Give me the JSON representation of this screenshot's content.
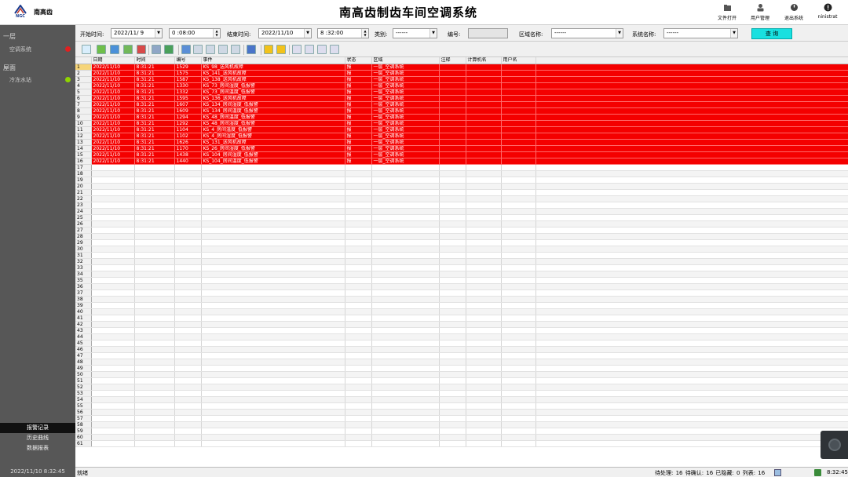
{
  "header": {
    "logo_text": "NGC",
    "company": "南高齿",
    "title": "南高齿制齿车间空调系统",
    "buttons": [
      {
        "label": "文件打开",
        "icon": "folder-icon"
      },
      {
        "label": "用户管理",
        "icon": "user-admin-icon"
      },
      {
        "label": "退出系统",
        "icon": "power-icon"
      },
      {
        "label": "ninistrat",
        "icon": "user-icon"
      }
    ]
  },
  "sidebar": {
    "groups": [
      {
        "label": "一层",
        "items": [
          {
            "label": "空调系统",
            "status": "alarm",
            "status_color": "#e02020"
          }
        ]
      },
      {
        "label": "屋面",
        "items": [
          {
            "label": "冷冻水站",
            "status": "normal",
            "status_color": "#8fd400"
          }
        ]
      }
    ],
    "bottom_buttons": [
      {
        "label": "报警记录",
        "active": true
      },
      {
        "label": "历史曲线",
        "active": false
      },
      {
        "label": "数据报表",
        "active": false
      }
    ],
    "datetime": "2022/11/10 8:32:45"
  },
  "filters": {
    "start_label": "开始时间:",
    "start_date": "2022/11/ 9",
    "start_time": "0 :08:00",
    "end_label": "结束时间:",
    "end_date": "2022/11/10",
    "end_time": "8 :32:00",
    "category_label": "类别:",
    "category_value": "------",
    "number_label": "编号:",
    "number_value": "",
    "area_label": "区域名称:",
    "area_value": "------",
    "system_label": "系统名称:",
    "system_value": "------",
    "query_label": "查 询"
  },
  "toolbar": {
    "tools": [
      "calendar-icon",
      "refresh-icon",
      "export-icon",
      "check-all-icon",
      "excel-icon",
      "print-icon",
      "print-preview-icon",
      "sort-icon",
      "move-top-icon",
      "move-up-icon",
      "move-down-icon",
      "move-bottom-icon",
      "filter-icon",
      "acknowledge-icon",
      "acknowledge-all-icon",
      "first-page-icon",
      "prev-page-icon",
      "next-page-icon",
      "last-page-icon"
    ]
  },
  "grid": {
    "columns": [
      "日期",
      "时间",
      "编号",
      "事件",
      "状态",
      "区域",
      "注释",
      "计算机名",
      "用户名"
    ],
    "row_count": 61,
    "selected_row": 1,
    "rows": [
      [
        "2022/11/10",
        "8:31:21",
        "1529",
        "KS_98_送风机故障",
        "报",
        "一层_空调系统",
        "",
        "",
        ""
      ],
      [
        "2022/11/10",
        "8:31:21",
        "1575",
        "KS_141_送风机故障",
        "报",
        "一层_空调系统",
        "",
        "",
        ""
      ],
      [
        "2022/11/10",
        "8:31:21",
        "1587",
        "KS_138_送风机故障",
        "报",
        "一层_空调系统",
        "",
        "",
        ""
      ],
      [
        "2022/11/10",
        "8:31:21",
        "1330",
        "KS_73_房间湿度_低报警",
        "报",
        "一层_空调系统",
        "",
        "",
        ""
      ],
      [
        "2022/11/10",
        "8:31:21",
        "1332",
        "KS_73_房间温度_低报警",
        "报",
        "一层_空调系统",
        "",
        "",
        ""
      ],
      [
        "2022/11/10",
        "8:31:21",
        "1595",
        "KS_136_送风机故障",
        "报",
        "一层_空调系统",
        "",
        "",
        ""
      ],
      [
        "2022/11/10",
        "8:31:21",
        "1607",
        "KS_134_房间湿度_低报警",
        "报",
        "一层_空调系统",
        "",
        "",
        ""
      ],
      [
        "2022/11/10",
        "8:31:21",
        "1609",
        "KS_134_房间温度_低报警",
        "报",
        "一层_空调系统",
        "",
        "",
        ""
      ],
      [
        "2022/11/10",
        "8:31:21",
        "1294",
        "KS_48_房间温度_低报警",
        "报",
        "一层_空调系统",
        "",
        "",
        ""
      ],
      [
        "2022/11/10",
        "8:31:21",
        "1292",
        "KS_48_房间湿度_低报警",
        "报",
        "一层_空调系统",
        "",
        "",
        ""
      ],
      [
        "2022/11/10",
        "8:31:21",
        "1104",
        "KS_4_房间温度_低报警",
        "报",
        "一层_空调系统",
        "",
        "",
        ""
      ],
      [
        "2022/11/10",
        "8:31:21",
        "1102",
        "KS_4_房间湿度_低报警",
        "报",
        "一层_空调系统",
        "",
        "",
        ""
      ],
      [
        "2022/11/10",
        "8:31:21",
        "1626",
        "KS_131_送风机故障",
        "报",
        "一层_空调系统",
        "",
        "",
        ""
      ],
      [
        "2022/11/10",
        "8:31:21",
        "1170",
        "KS_26_房间湿度_低报警",
        "报",
        "一层_空调系统",
        "",
        "",
        ""
      ],
      [
        "2022/11/10",
        "8:31:21",
        "1438",
        "KS_104_房间湿度_低报警",
        "报",
        "一层_空调系统",
        "",
        "",
        ""
      ],
      [
        "2022/11/10",
        "8:31:21",
        "1440",
        "KS_104_房间温度_低报警",
        "报",
        "一层_空调系统",
        "",
        "",
        ""
      ]
    ]
  },
  "statusbar": {
    "status": "就绪",
    "counts": "待处理: 16  待确认: 16  已隐藏: 0  列表: 16",
    "time": "8:32:45"
  }
}
